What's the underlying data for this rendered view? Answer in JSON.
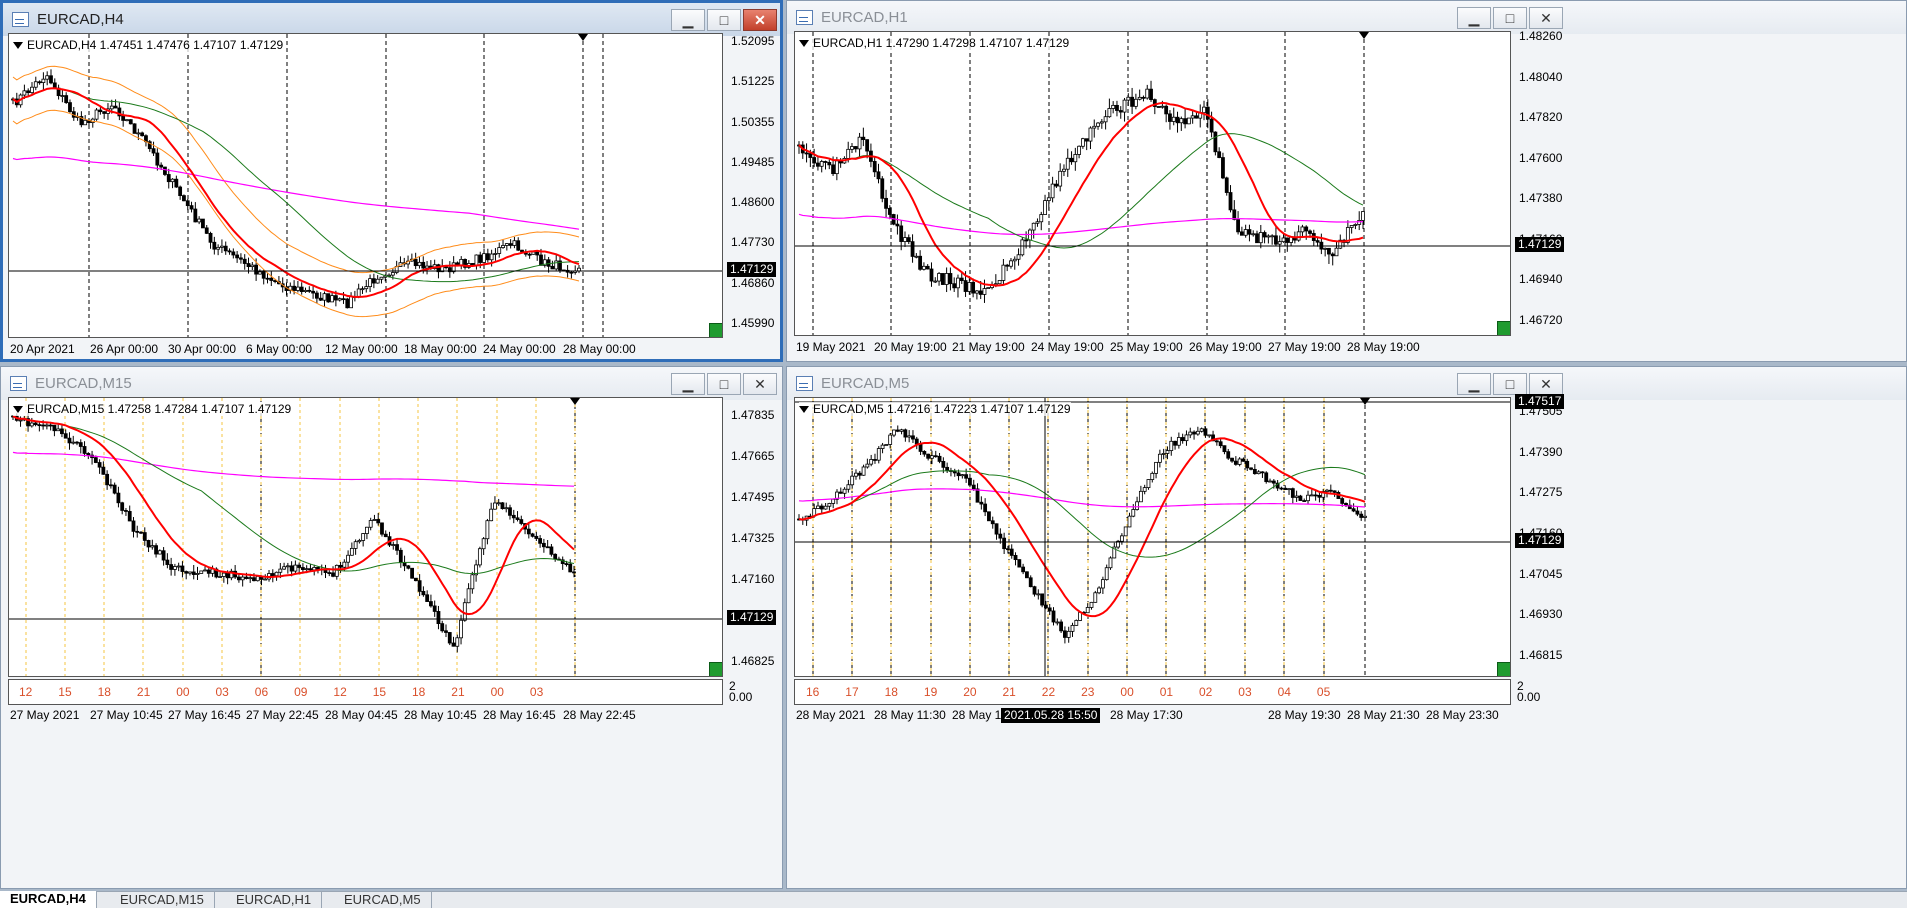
{
  "tabs": [
    "EURCAD,H4",
    "EURCAD,M15",
    "EURCAD,H1",
    "EURCAD,M5"
  ],
  "active_tab": 0,
  "windows": {
    "h4": {
      "title": "EURCAD,H4",
      "info": "EURCAD,H4  1.47451 1.47476 1.47107 1.47129",
      "prices": [
        "1.52095",
        "1.51225",
        "1.50355",
        "1.49485",
        "1.48600",
        "1.47730",
        "1.46860",
        "1.45990"
      ],
      "current": "1.47129",
      "times": [
        "20 Apr 2021",
        "26 Apr 00:00",
        "30 Apr 00:00",
        "6 May 00:00",
        "12 May 00:00",
        "18 May 00:00",
        "24 May 00:00",
        "28 May 00:00"
      ]
    },
    "h1": {
      "title": "EURCAD,H1",
      "info": "EURCAD,H1  1.47290 1.47298 1.47107 1.47129",
      "prices": [
        "1.48260",
        "1.48040",
        "1.47820",
        "1.47600",
        "1.47380",
        "1.47160",
        "1.46940",
        "1.46720"
      ],
      "current": "1.47129",
      "times": [
        "19 May 2021",
        "20 May 19:00",
        "21 May 19:00",
        "24 May 19:00",
        "25 May 19:00",
        "26 May 19:00",
        "27 May 19:00",
        "28 May 19:00"
      ]
    },
    "m15": {
      "title": "EURCAD,M15",
      "info": "EURCAD,M15  1.47258 1.47284 1.47107 1.47129",
      "prices": [
        "1.47835",
        "1.47665",
        "1.47495",
        "1.47325",
        "1.47160",
        "1.46990",
        "1.46825"
      ],
      "current": "1.47129",
      "hours": [
        "12",
        "15",
        "18",
        "21",
        "00",
        "03",
        "06",
        "09",
        "12",
        "15",
        "18",
        "21",
        "00",
        "03"
      ],
      "sub_scale": [
        "2",
        "0.00"
      ],
      "times": [
        "27 May 2021",
        "27 May 10:45",
        "27 May 16:45",
        "27 May 22:45",
        "28 May 04:45",
        "28 May 10:45",
        "28 May 16:45",
        "28 May 22:45"
      ]
    },
    "m5": {
      "title": "EURCAD,M5",
      "info": "EURCAD,M5  1.47216 1.47223 1.47107 1.47129",
      "prices": [
        "1.47505",
        "1.47390",
        "1.47275",
        "1.47160",
        "1.47045",
        "1.46930",
        "1.46815"
      ],
      "current": "1.47129",
      "crosshair_price": "1.47517",
      "crosshair_time": "2021.05.28 15:50",
      "hours": [
        "16",
        "17",
        "18",
        "19",
        "20",
        "21",
        "22",
        "23",
        "00",
        "01",
        "02",
        "03",
        "04",
        "05"
      ],
      "sub_scale": [
        "2",
        "0.00"
      ],
      "times": [
        "28 May 2021",
        "28 May 11:30",
        "28 May 13",
        "28 May 17:30",
        "28 May 19:30",
        "28 May 21:30",
        "28 May 23:30"
      ]
    }
  },
  "colors": {
    "candle": "#000000",
    "ma_fast": "#ff0000",
    "ma_mid": "#1b7a1b",
    "ma_slow": "#ff00ff",
    "bands": "#ff8c1a",
    "grid_day": "#000000",
    "grid_hour": "#f5c542"
  }
}
